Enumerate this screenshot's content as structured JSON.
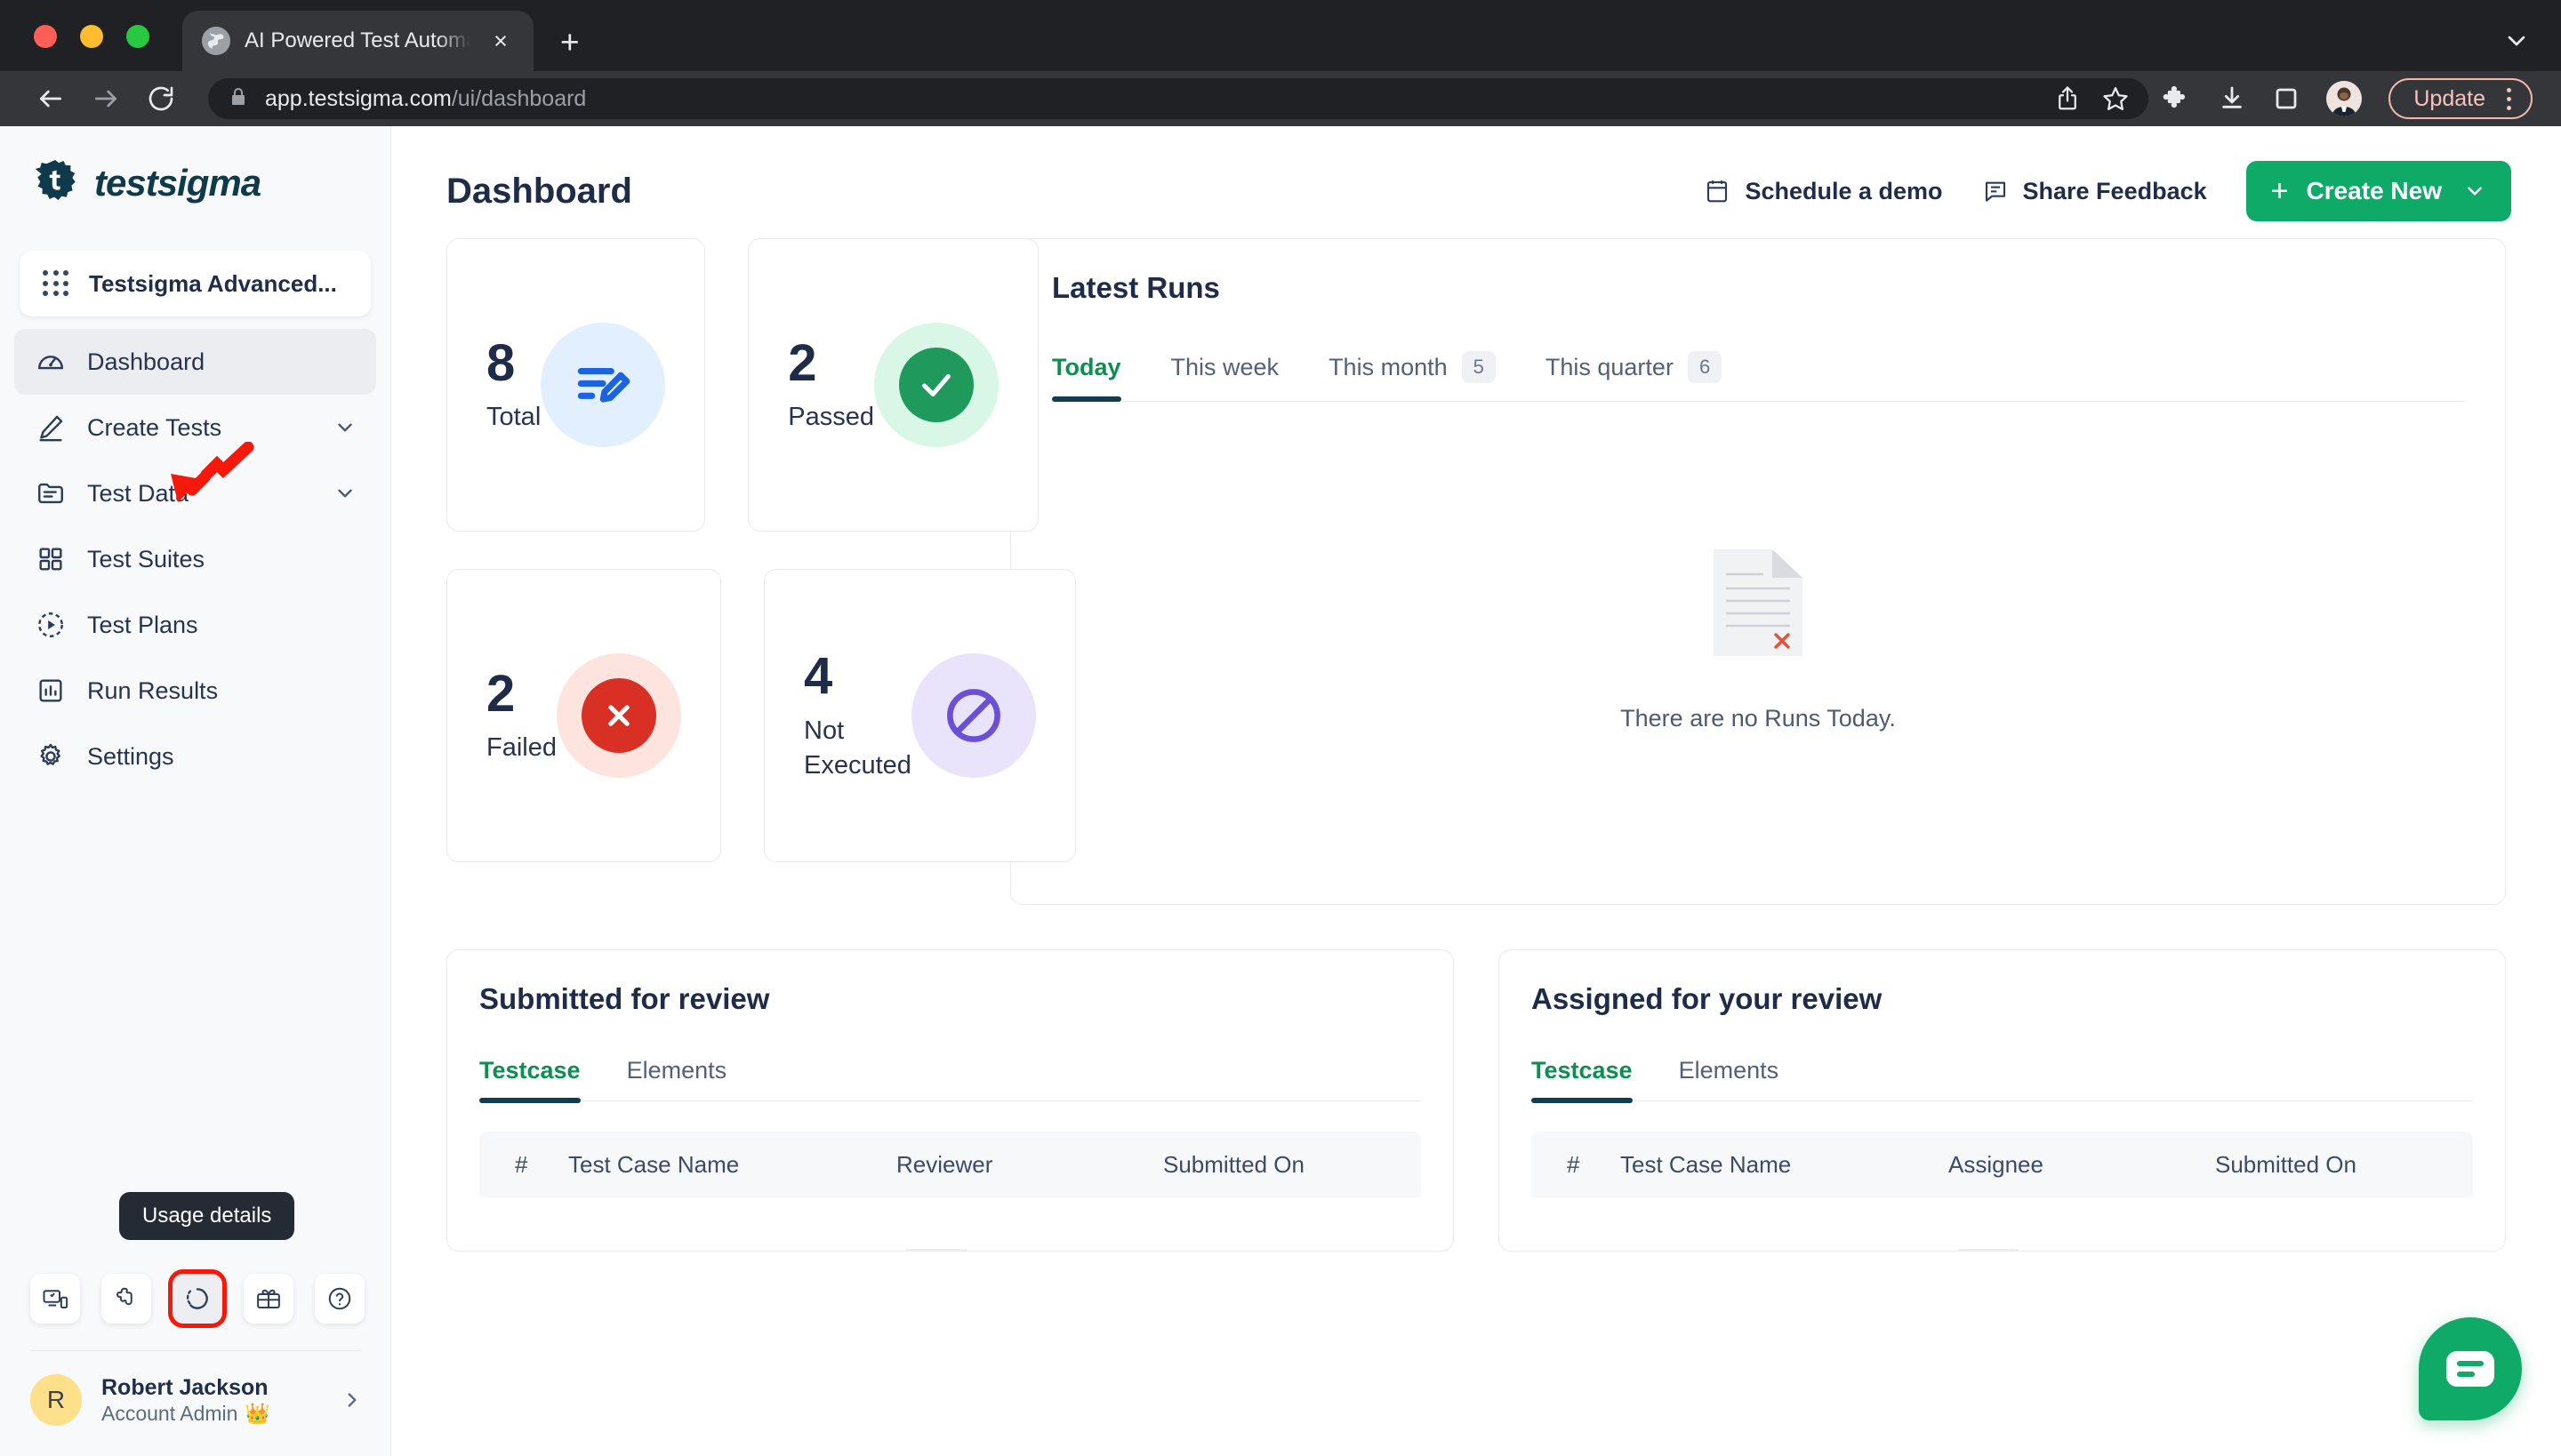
{
  "browser": {
    "tab": {
      "title": "AI Powered Test Automation Platform",
      "favicon": "globe-icon",
      "close": "×"
    },
    "new_tab_label": "+",
    "url_host": "app.testsigma.com",
    "url_path": "/ui/dashboard",
    "update_label": "Update",
    "icons": {
      "back": "back-arrow-icon",
      "forward": "forward-arrow-icon",
      "reload": "reload-icon",
      "lock": "lock-icon",
      "share": "share-icon",
      "bookmark": "star-icon",
      "extensions": "puzzle-icon",
      "downloads": "download-icon",
      "sidepanel": "side-panel-icon",
      "profile": "profile-avatar",
      "menu": "kebab-menu-icon",
      "tablist": "chevron-down-icon"
    }
  },
  "sidebar": {
    "brand": "testsigma",
    "project": {
      "name": "Testsigma Advanced...",
      "icon": "grid-9-dots-icon"
    },
    "items": [
      {
        "label": "Dashboard",
        "icon": "speedometer-icon",
        "active": true,
        "expandable": false
      },
      {
        "label": "Create Tests",
        "icon": "pencil-icon",
        "active": false,
        "expandable": true
      },
      {
        "label": "Test Data",
        "icon": "folder-list-icon",
        "active": false,
        "expandable": true
      },
      {
        "label": "Test Suites",
        "icon": "grid-squares-icon",
        "active": false,
        "expandable": false
      },
      {
        "label": "Test Plans",
        "icon": "play-circle-dashed-icon",
        "active": false,
        "expandable": false
      },
      {
        "label": "Run Results",
        "icon": "bar-chart-icon",
        "active": false,
        "expandable": false
      },
      {
        "label": "Settings",
        "icon": "gear-icon",
        "active": false,
        "expandable": false
      }
    ],
    "tooltip": "Usage details",
    "util_buttons": [
      {
        "name": "devices-icon",
        "highlighted": false
      },
      {
        "name": "puzzle-piece-icon",
        "highlighted": false
      },
      {
        "name": "usage-donut-icon",
        "highlighted": true
      },
      {
        "name": "gift-card-icon",
        "highlighted": false
      },
      {
        "name": "help-question-icon",
        "highlighted": false
      }
    ],
    "user": {
      "initial": "R",
      "name": "Robert Jackson",
      "role": "Account Admin",
      "crown": "👑"
    }
  },
  "header": {
    "title": "Dashboard",
    "schedule_demo": "Schedule a demo",
    "share_feedback": "Share Feedback",
    "create_new": "Create New",
    "create_plus": "+"
  },
  "stats": [
    {
      "value": "8",
      "label": "Total",
      "icon": "edit-list-icon",
      "badge_color": "#e2efff"
    },
    {
      "value": "2",
      "label": "Passed",
      "icon": "check-icon",
      "badge_color": "#d9f7e7"
    },
    {
      "value": "2",
      "label": "Failed",
      "icon": "cross-icon",
      "badge_color": "#fde4df"
    },
    {
      "value": "4",
      "label": "Not Executed",
      "icon": "blocked-icon",
      "badge_color": "#e9e4fb"
    }
  ],
  "latest_runs": {
    "title": "Latest Runs",
    "tabs": [
      {
        "label": "Today",
        "count": "",
        "selected": true
      },
      {
        "label": "This week",
        "count": "",
        "selected": false
      },
      {
        "label": "This month",
        "count": "5",
        "selected": false
      },
      {
        "label": "This quarter",
        "count": "6",
        "selected": false
      }
    ],
    "empty_text": "There are no Runs Today.",
    "empty_icon": "document-error-icon"
  },
  "submitted_for_review": {
    "title": "Submitted for review",
    "tabs": [
      {
        "label": "Testcase",
        "selected": true
      },
      {
        "label": "Elements",
        "selected": false
      }
    ],
    "columns": [
      "#",
      "Test Case Name",
      "Reviewer",
      "Submitted On"
    ],
    "rows": []
  },
  "assigned_for_review": {
    "title": "Assigned for your review",
    "tabs": [
      {
        "label": "Testcase",
        "selected": true
      },
      {
        "label": "Elements",
        "selected": false
      }
    ],
    "columns": [
      "#",
      "Test Case Name",
      "Assignee",
      "Submitted On"
    ],
    "rows": []
  },
  "chat": {
    "icon": "chat-bubble-icon"
  },
  "colors": {
    "brand_green": "#0fa968",
    "tab_active_green": "#0e8f52",
    "tab_underline": "#123c4f",
    "text_dark": "#1e2c4a",
    "sidebar_bg": "#f8f9fb",
    "passed": "#1f9a5c",
    "failed": "#d93025",
    "not_executed": "#6b4fd6",
    "total": "#1b63e0",
    "annotation_red": "#f5180b"
  }
}
